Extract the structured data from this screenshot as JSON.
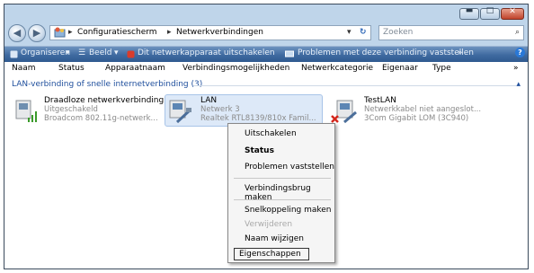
{
  "window": {
    "minimize_glyph": "▬",
    "maximize_glyph": "□",
    "close_glyph": "✕"
  },
  "address": {
    "back_glyph": "◀",
    "forward_glyph": "▶",
    "crumbs": [
      "Configuratiescherm",
      "Netwerkverbindingen"
    ],
    "separator": "▸",
    "dropdown_glyph": "▾",
    "refresh_glyph": "↻",
    "search_placeholder": "Zoeken",
    "search_icon": "⌕"
  },
  "toolbar": {
    "organize": "Organiseren",
    "views": "Beeld",
    "disable": "Dit netwerkapparaat uitschakelen",
    "diagnose": "Problemen met deze verbinding vaststellen",
    "more": "»",
    "help": "?"
  },
  "columns": [
    "Naam",
    "Status",
    "Apparaatnaam",
    "Verbindingsmogelijkheden",
    "Netwerkcategorie",
    "Eigenaar",
    "Type"
  ],
  "columns_more": "»",
  "group": {
    "title": "LAN-verbinding of snelle internetverbinding (3)",
    "collapse_glyph": "▴"
  },
  "items": [
    {
      "name": "Draadloze netwerkverbinding",
      "status": "Uitgeschakeld",
      "device": "Broadcom 802.11g-netwerk..."
    },
    {
      "name": "LAN",
      "status": "Netwerk 3",
      "device": "Realtek RTL8139/810x Famil..."
    },
    {
      "name": "TestLAN",
      "status": "Netwerkkabel niet aangeslot...",
      "device": "3Com Gigabit LOM (3C940)"
    }
  ],
  "context_menu": {
    "disable": "Uitschakelen",
    "status": "Status",
    "diagnose": "Problemen vaststellen",
    "bridge": "Verbindingsbrug maken",
    "shortcut": "Snelkoppeling maken",
    "delete": "Verwijderen",
    "rename": "Naam wijzigen",
    "properties": "Eigenschappen"
  }
}
